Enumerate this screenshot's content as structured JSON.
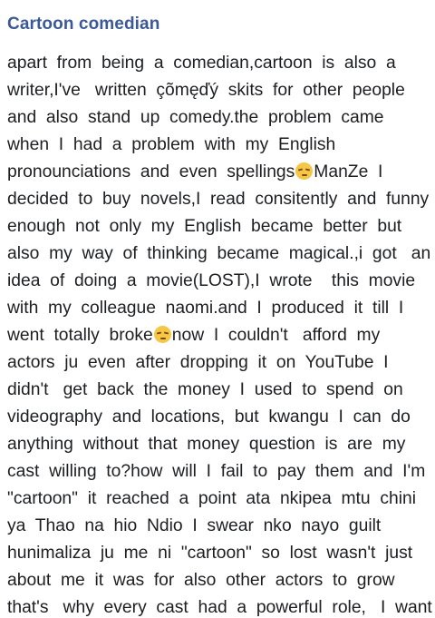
{
  "post": {
    "title": "Cartoon comedian",
    "lines": [
      "apart  from  being  a  comedian,cartoon  is  also  a",
      "writer,I've   written  çõmęďý  skits  for  other  people",
      "and  also  stand  up  comedy.the  problem  came",
      "when  I  had  a  problem  with  my  English",
      "pronounciations  and  even  spellings",
      "ManZe  I",
      "decided  to  buy  novels,I  read  consitently  and  funny",
      "enough  not  only  my  English  became  better  but",
      "also  my  way  of  thinking  became  magical.,i  got   an  I",
      "idea  of  doing  a  movie(LOST),I  wrote    this  movie",
      "with  my  colleague  naomi.and  I  produced  it  till  I",
      "went  totally  broke",
      "now  I  couldn't   afford  my",
      "actors  ju  even  after  dropping  it  on  YouTube  I",
      "didn't   get  back  the  money  I  used  to  spend  on",
      "videography  and  locations,  but  kwangu  I  can  do",
      "anything  without  that  money  question  is  are  my",
      "cast  willing  to?how  will  I  fail  to  pay  them  and  I'm",
      "\"cartoon\"  it  reached  a  point  ata  nkipea  mtu  chini",
      "ya  Thao  na  hio  Ndio  I  swear  nko  nayo  guilt",
      "hunimaliza  ju  me  ni  \"cartoon\"  so  lost  wasn't  just",
      "about  me  it  was  for  also  other  actors  to  grow",
      "that's   why  every  cast  had  a  powerful  role,   I  want"
    ],
    "emojis": {
      "unamused": "unamused-face-emoji",
      "pensive": "pensive-face-emoji"
    }
  }
}
